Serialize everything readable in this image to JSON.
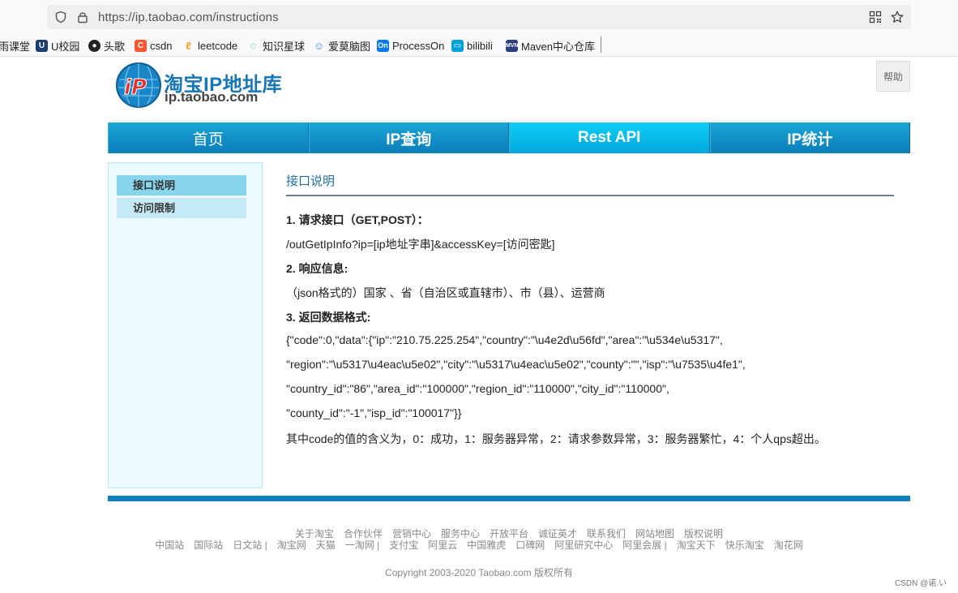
{
  "browser": {
    "url": "https://ip.taobao.com/instructions",
    "bookmarks": [
      {
        "label": "雨课堂",
        "icon": "rain-classroom-icon",
        "color": "#444444"
      },
      {
        "label": "U校园",
        "icon": "u-campus-icon",
        "color": "#1c3f73"
      },
      {
        "label": "头歌",
        "icon": "github-icon",
        "color": "#222222"
      },
      {
        "label": "csdn",
        "icon": "csdn-icon",
        "color": "#fc5531"
      },
      {
        "label": "leetcode",
        "icon": "leetcode-icon",
        "color": "#f89f1b"
      },
      {
        "label": "知识星球",
        "icon": "zsxq-icon",
        "color": "#19c28c"
      },
      {
        "label": "爱莫脑图",
        "icon": "amnaotu-icon",
        "color": "#3a8ee6"
      },
      {
        "label": "ProcessOn",
        "icon": "processon-icon",
        "color": "#067bef"
      },
      {
        "label": "bilibili",
        "icon": "bilibili-icon",
        "color": "#00a1d6"
      },
      {
        "label": "Maven中心仓库",
        "icon": "maven-icon",
        "color": "#2b3f7d"
      }
    ]
  },
  "header": {
    "logo_title": "淘宝IP地址库",
    "logo_domain": "ip.taobao.com",
    "help_label": "帮助"
  },
  "nav": {
    "tabs": [
      {
        "label": "首页"
      },
      {
        "label": "IP查询"
      },
      {
        "label": "Rest API"
      },
      {
        "label": "IP统计"
      }
    ],
    "active_index": 2
  },
  "sidebar": {
    "items": [
      {
        "label": "接口说明"
      },
      {
        "label": "访问限制"
      }
    ]
  },
  "content": {
    "title": "接口说明",
    "lines": [
      "1. 请求接口（GET,POST）：",
      "/outGetIpInfo?ip=[ip地址字串]&accessKey=[访问密匙]",
      "2. 响应信息:",
      "（json格式的）国家 、省（自治区或直辖市）、市（县）、运营商",
      "3. 返回数据格式:",
      "{\"code\":0,\"data\":{\"ip\":\"210.75.225.254\",\"country\":\"\\u4e2d\\u56fd\",\"area\":\"\\u534e\\u5317\",",
      "\"region\":\"\\u5317\\u4eac\\u5e02\",\"city\":\"\\u5317\\u4eac\\u5e02\",\"county\":\"\",\"isp\":\"\\u7535\\u4fe1\",",
      "\"country_id\":\"86\",\"area_id\":\"100000\",\"region_id\":\"110000\",\"city_id\":\"110000\",",
      "\"county_id\":\"-1\",\"isp_id\":\"100017\"}}",
      "其中code的值的含义为，0：成功，1：服务器异常，2：请求参数异常，3：服务器繁忙，4：个人qps超出。"
    ]
  },
  "footer": {
    "row1": [
      "关于淘宝",
      "合作伙伴",
      "营销中心",
      "服务中心",
      "开放平台",
      "诚征英才",
      "联系我们",
      "网站地图",
      "版权说明"
    ],
    "row2": [
      "中国站",
      "国际站",
      "日文站 |",
      "淘宝网",
      "天猫",
      "一淘网 |",
      "支付宝",
      "阿里云",
      "中国雅虎",
      "口碑网",
      "阿里研究中心",
      "阿里会展 |",
      "淘宝天下",
      "快乐淘宝",
      "淘花网"
    ],
    "copyright": "Copyright 2003-2020 Taobao.com 版权所有",
    "watermark": "CSDN @诺.い"
  }
}
